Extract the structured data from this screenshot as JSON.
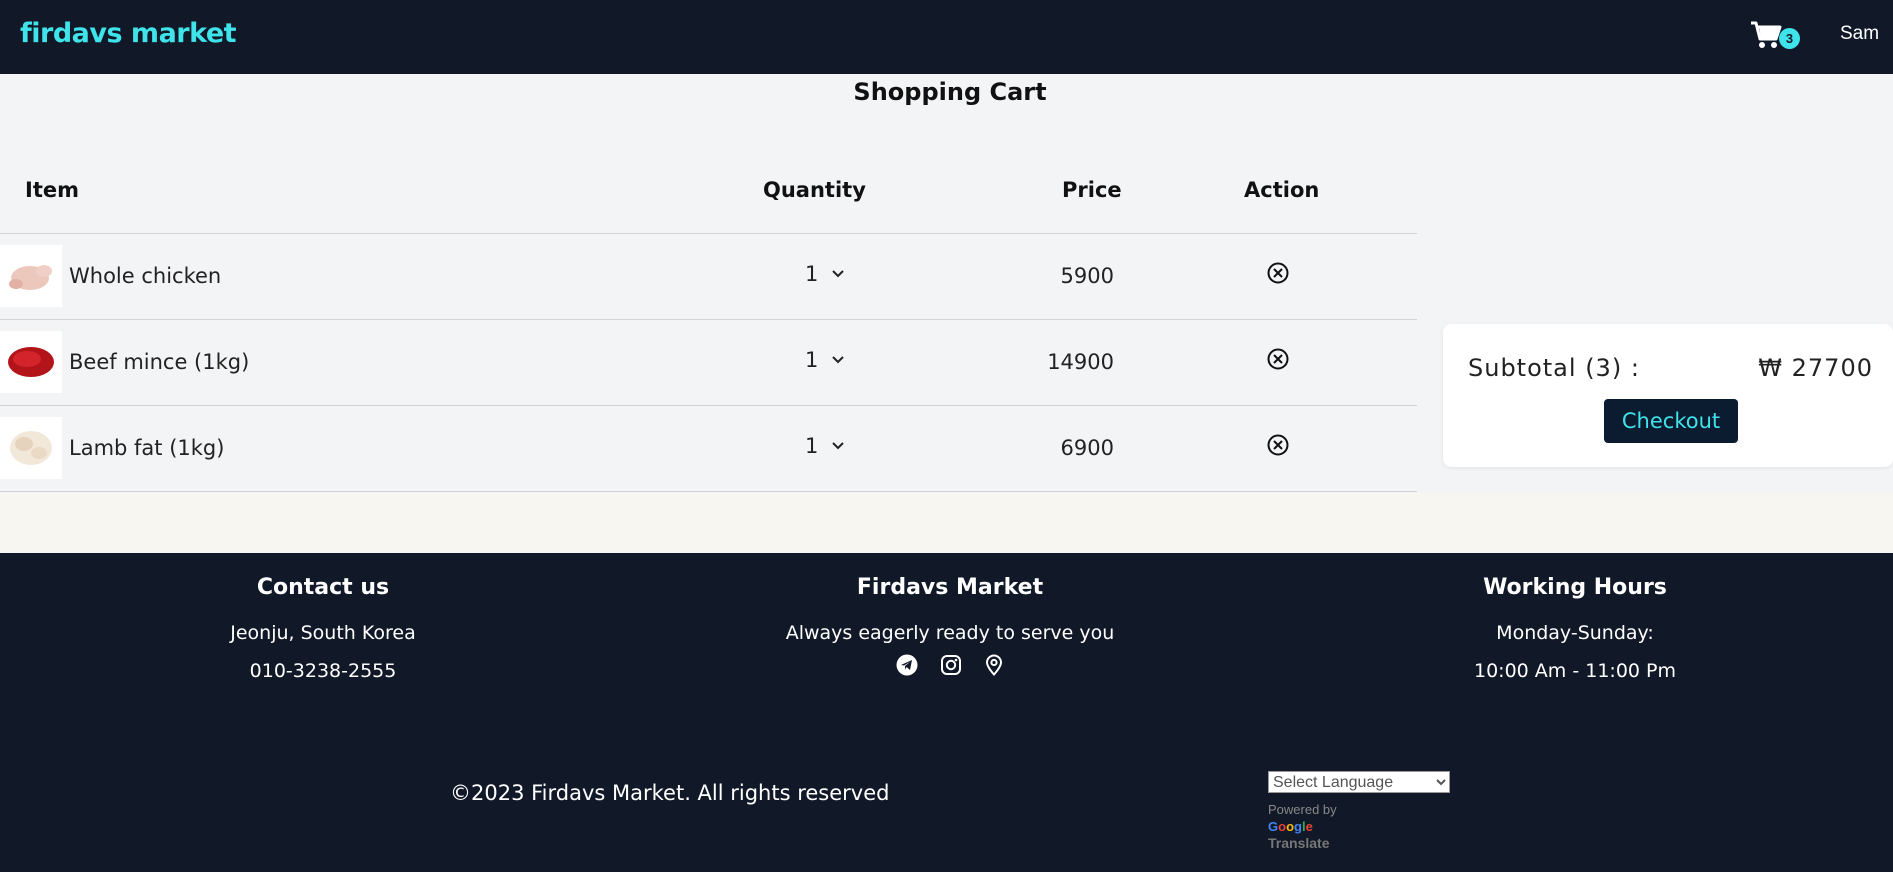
{
  "header": {
    "brand": "firdavs market",
    "cart_count": "3",
    "user": "Sam"
  },
  "cart": {
    "title": "Shopping Cart",
    "columns": {
      "item": "Item",
      "quantity": "Quantity",
      "price": "Price",
      "action": "Action"
    },
    "items": [
      {
        "name": "Whole chicken",
        "qty": "1",
        "price": "5900",
        "thumb_color": "#e8c2b8"
      },
      {
        "name": "Beef mince (1kg)",
        "qty": "1",
        "price": "14900",
        "thumb_color": "#c4161c"
      },
      {
        "name": "Lamb fat (1kg)",
        "qty": "1",
        "price": "6900",
        "thumb_color": "#f1e6d7"
      }
    ]
  },
  "summary": {
    "label": "Subtotal (3) :",
    "value": "₩ 27700",
    "checkout": "Checkout"
  },
  "footer": {
    "contact": {
      "title": "Contact us",
      "address": "Jeonju, South Korea",
      "phone": "010-3238-2555"
    },
    "market": {
      "title": "Firdavs Market",
      "tagline": "Always eagerly ready to serve you",
      "icons": [
        "telegram-icon",
        "instagram-icon",
        "location-pin-icon"
      ]
    },
    "hours": {
      "title": "Working Hours",
      "days": "Monday-Sunday:",
      "time": "10:00 Am - 11:00 Pm"
    },
    "copyright": "©2023 Firdavs Market. All rights reserved",
    "language_select": "Select Language",
    "powered_by": "Powered by",
    "translate": "Translate"
  },
  "colors": {
    "nav_bg": "#111827",
    "accent": "#3fe3ea",
    "checkout_bg": "#0b1b30"
  }
}
